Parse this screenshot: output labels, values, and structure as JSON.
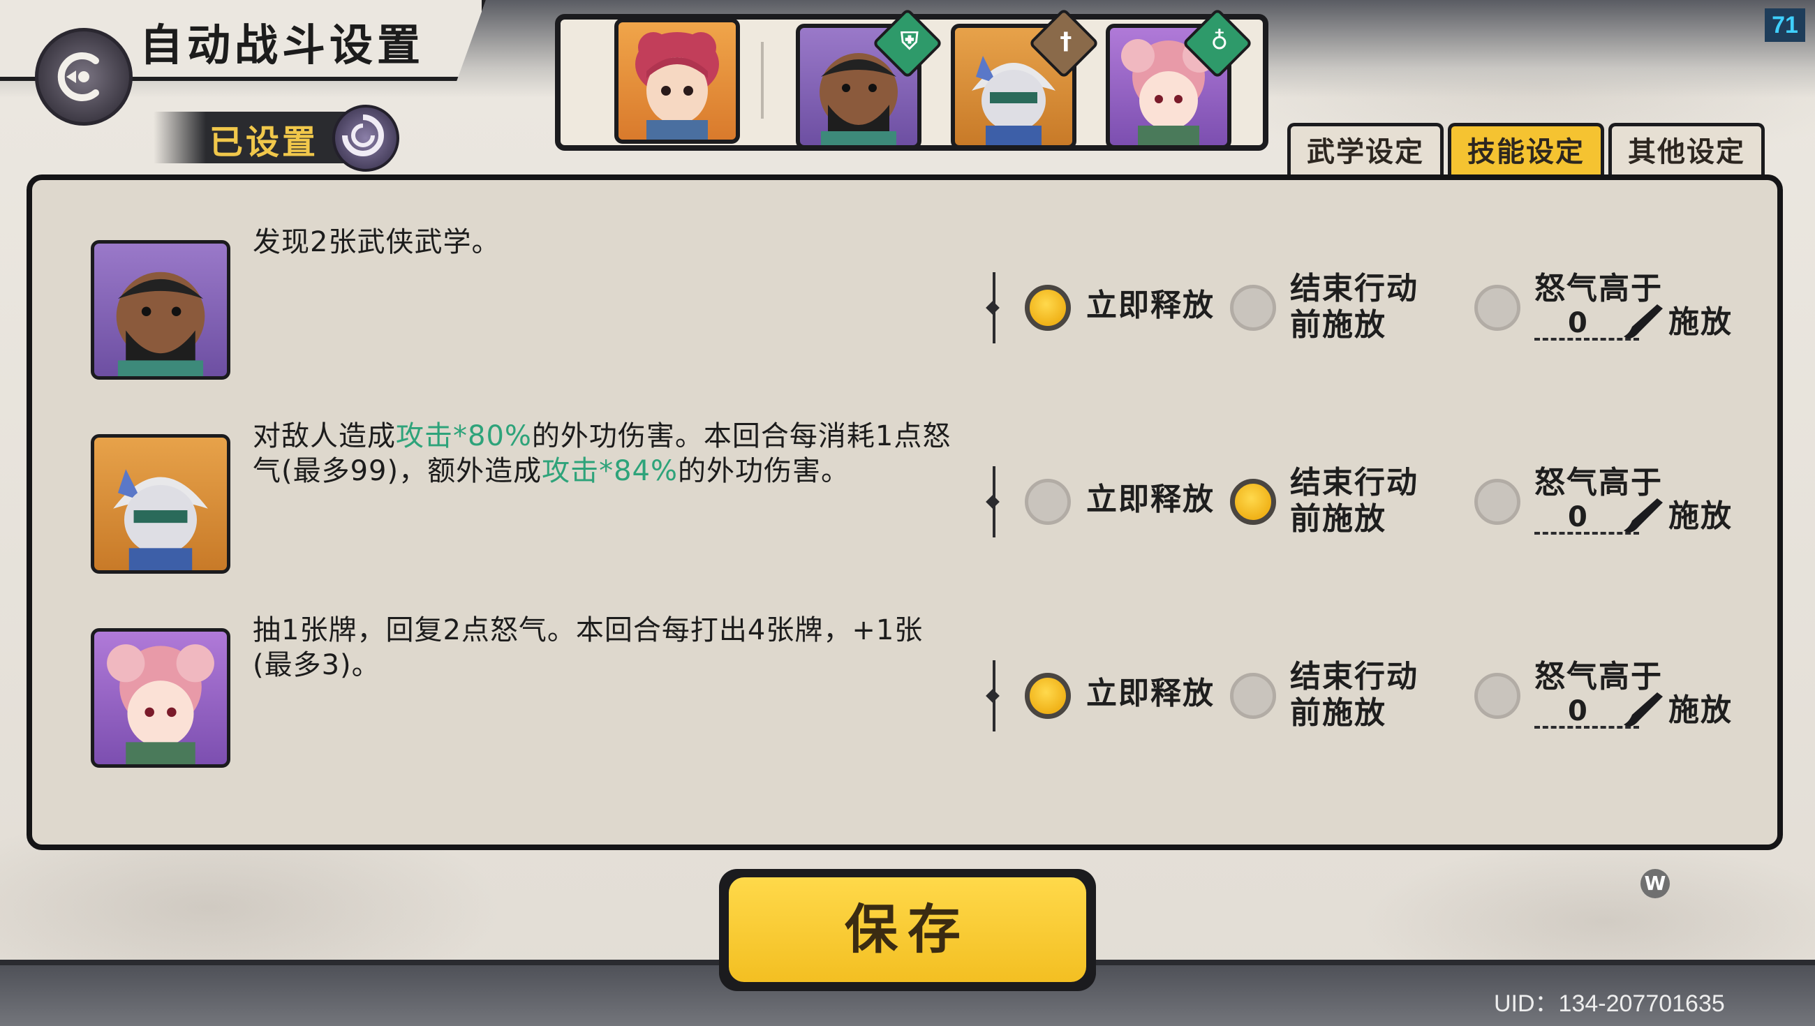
{
  "header": {
    "title": "自动战斗设置",
    "status_label": "已设置",
    "fps": "71"
  },
  "team": [
    {
      "name": "pink-hair-hero",
      "badge": ""
    },
    {
      "name": "bearded-warrior",
      "badge": "shield-icon"
    },
    {
      "name": "masked-fighter",
      "badge": "sword-icon"
    },
    {
      "name": "pink-healer",
      "badge": "gourd-icon"
    }
  ],
  "tabs": [
    {
      "label": "武学设定",
      "active": false
    },
    {
      "label": "技能设定",
      "active": true
    },
    {
      "label": "其他设定",
      "active": false
    }
  ],
  "options": {
    "immediate": "立即释放",
    "end_line1": "结束行动",
    "end_line2": "前施放",
    "rage_line1": "怒气高于",
    "rage_suffix": "施放"
  },
  "rows": [
    {
      "desc_parts": [
        "发现2张武侠武学。"
      ],
      "selected": "immediate",
      "rage_threshold": "0"
    },
    {
      "desc_a": "对敌人造成",
      "desc_hl1": "攻击*80%",
      "desc_b": "的外功伤害。本回合每消耗1点怒气(最多99)，额外造成",
      "desc_hl2": "攻击*84%",
      "desc_c": "的外功伤害。",
      "selected": "end",
      "rage_threshold": "0"
    },
    {
      "desc_parts": [
        "抽1张牌，回复2点怒气。本回合每打出4张牌，+1张(最多3)。"
      ],
      "selected": "immediate",
      "rage_threshold": "0"
    }
  ],
  "save_label": "保存",
  "w_label": "W",
  "uid": "UID：134-207701635"
}
